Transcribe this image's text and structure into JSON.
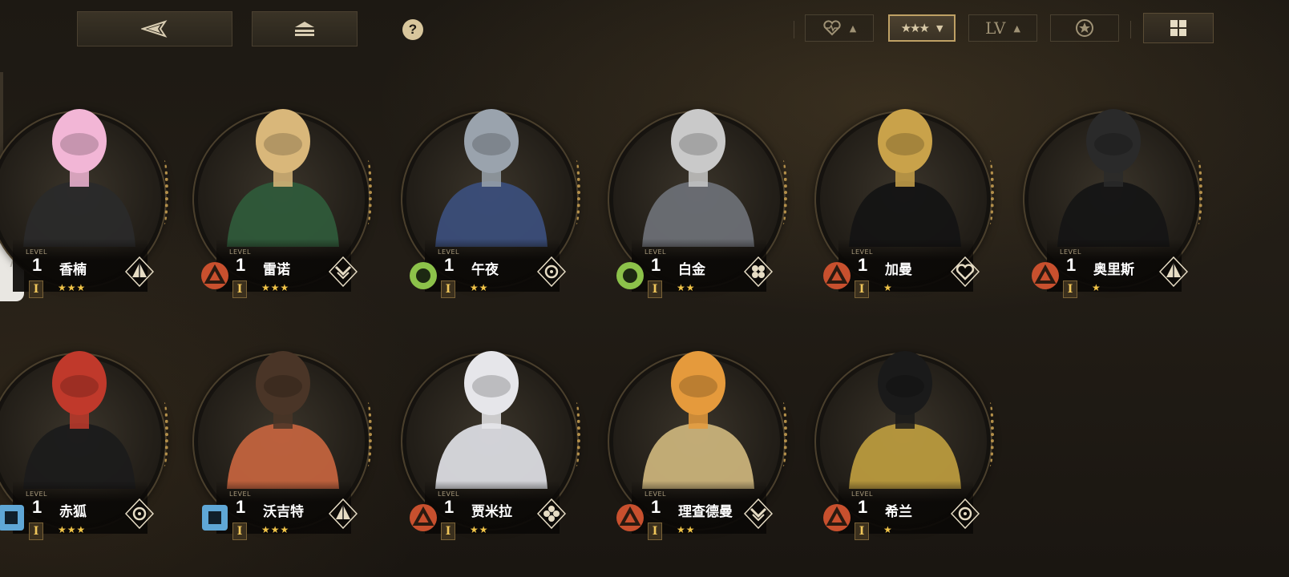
{
  "topbar": {
    "back_icon": "back-triangle-icon",
    "home_icon": "stack-home-icon",
    "help_label": "?",
    "sort_buttons": {
      "heart_icon": "heart-pulse-icon",
      "rarity_icon": "three-stars-icon",
      "level_label": "LV",
      "attribute_icon": "star-circle-icon"
    },
    "view_icon": "grid-view-icon",
    "active_sort": "rarity"
  },
  "side_tab": {
    "chevron": "⟩"
  },
  "colors": {
    "accent_gold": "#bfa165",
    "star": "#f2c548",
    "element_red": "#c8502e",
    "element_green": "#8cc24a",
    "element_blue": "#5fa7d6"
  },
  "level_label": "LEVEL",
  "characters": [
    {
      "name": "香楠",
      "level": "1",
      "rank": "I",
      "stars": "★★★",
      "element": "none",
      "role_icon": "pyramid-role-icon"
    },
    {
      "name": "雷诺",
      "level": "1",
      "rank": "I",
      "stars": "★★★",
      "element": "red",
      "role_icon": "chevron-role-icon"
    },
    {
      "name": "午夜",
      "level": "1",
      "rank": "I",
      "stars": "★★",
      "element": "green",
      "role_icon": "target-role-icon"
    },
    {
      "name": "白金",
      "level": "1",
      "rank": "I",
      "stars": "★★",
      "element": "green",
      "role_icon": "hex-role-icon"
    },
    {
      "name": "加曼",
      "level": "1",
      "rank": "I",
      "stars": "★",
      "element": "red",
      "role_icon": "heart-role-icon"
    },
    {
      "name": "奥里斯",
      "level": "1",
      "rank": "I",
      "stars": "★",
      "element": "red",
      "role_icon": "pyramid-role-icon"
    },
    {
      "name": "赤狐",
      "level": "1",
      "rank": "I",
      "stars": "★★★",
      "element": "blue",
      "role_icon": "target-role-icon"
    },
    {
      "name": "沃吉特",
      "level": "1",
      "rank": "I",
      "stars": "★★★",
      "element": "blue",
      "role_icon": "pyramid-role-icon"
    },
    {
      "name": "贾米拉",
      "level": "1",
      "rank": "I",
      "stars": "★★",
      "element": "red",
      "role_icon": "flower-role-icon"
    },
    {
      "name": "理查德曼",
      "level": "1",
      "rank": "I",
      "stars": "★★",
      "element": "red",
      "role_icon": "chevron-role-icon"
    },
    {
      "name": "希兰",
      "level": "1",
      "rank": "I",
      "stars": "★",
      "element": "red",
      "role_icon": "target-role-icon"
    }
  ]
}
